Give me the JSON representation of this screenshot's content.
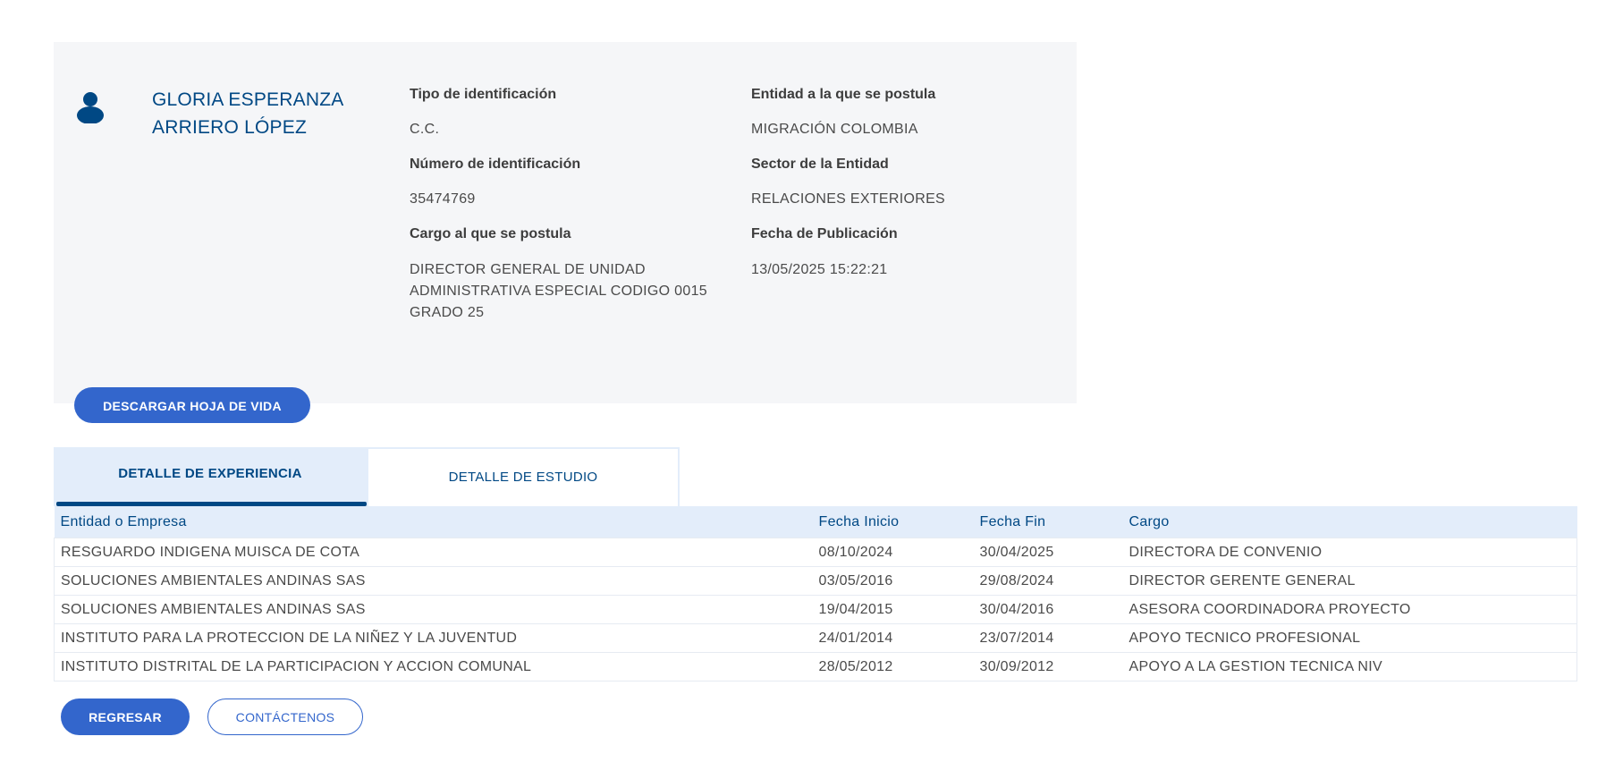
{
  "profile": {
    "name": "GLORIA ESPERANZA ARRIERO LÓPEZ",
    "avatar_icon": "user-icon",
    "fields_left": [
      {
        "label": "Tipo de identificación",
        "value": "C.C."
      },
      {
        "label": "Número de identificación",
        "value": "35474769"
      },
      {
        "label": "Cargo al que se postula",
        "value": "DIRECTOR GENERAL DE UNIDAD ADMINISTRATIVA ESPECIAL CODIGO 0015 GRADO 25"
      }
    ],
    "fields_right": [
      {
        "label": "Entidad a la que se postula",
        "value": "MIGRACIÓN COLOMBIA"
      },
      {
        "label": "Sector de la Entidad",
        "value": "RELACIONES EXTERIORES"
      },
      {
        "label": "Fecha de Publicación",
        "value": "13/05/2025 15:22:21"
      }
    ],
    "download_label": "DESCARGAR HOJA DE VIDA"
  },
  "tabs": [
    {
      "label": "DETALLE DE EXPERIENCIA",
      "active": true
    },
    {
      "label": "DETALLE DE ESTUDIO",
      "active": false
    }
  ],
  "table": {
    "headers": [
      "Entidad o Empresa",
      "Fecha Inicio",
      "Fecha Fin",
      "Cargo"
    ],
    "rows": [
      [
        "RESGUARDO INDIGENA MUISCA DE COTA",
        "08/10/2024",
        "30/04/2025",
        "DIRECTORA DE CONVENIO"
      ],
      [
        "SOLUCIONES AMBIENTALES ANDINAS SAS",
        "03/05/2016",
        "29/08/2024",
        "DIRECTOR GERENTE GENERAL"
      ],
      [
        "SOLUCIONES AMBIENTALES ANDINAS SAS",
        "19/04/2015",
        "30/04/2016",
        "ASESORA COORDINADORA PROYECTO"
      ],
      [
        "INSTITUTO PARA LA PROTECCION DE LA NIÑEZ Y LA JUVENTUD",
        "24/01/2014",
        "23/07/2014",
        "APOYO TECNICO PROFESIONAL"
      ],
      [
        "INSTITUTO DISTRITAL DE LA PARTICIPACION Y ACCION COMUNAL",
        "28/05/2012",
        "30/09/2012",
        "APOYO A LA GESTION TECNICA NIV"
      ]
    ]
  },
  "actions": {
    "back_label": "REGRESAR",
    "contact_label": "CONTÁCTENOS"
  },
  "colors": {
    "primary": "#3366cc",
    "heading": "#004884",
    "card_bg": "#f5f6f8",
    "header_bg": "#e3edfa"
  }
}
